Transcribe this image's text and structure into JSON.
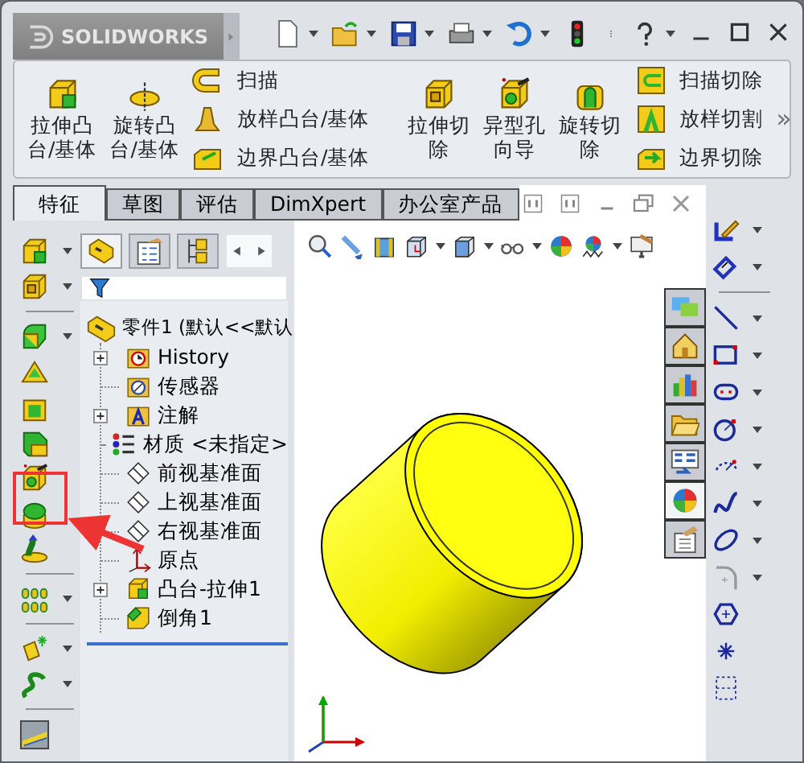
{
  "app": {
    "name": "SOLIDWORKS"
  },
  "ribbon": {
    "groups": [
      {
        "kind": "large",
        "lines": [
          "拉伸凸",
          "台/基体"
        ]
      },
      {
        "kind": "large",
        "lines": [
          "旋转凸",
          "台/基体"
        ]
      },
      {
        "kind": "stack",
        "items": [
          "扫描",
          "放样凸台/基体",
          "边界凸台/基体"
        ]
      },
      {
        "kind": "divider"
      },
      {
        "kind": "large",
        "lines": [
          "拉伸切",
          "除"
        ]
      },
      {
        "kind": "large",
        "lines": [
          "异型孔",
          "向导"
        ]
      },
      {
        "kind": "large",
        "lines": [
          "旋转切",
          "除"
        ]
      },
      {
        "kind": "stack",
        "items": [
          "扫描切除",
          "放样切割",
          "边界切除"
        ]
      }
    ],
    "more": "»"
  },
  "tabs": [
    {
      "label": "特征",
      "selected": true
    },
    {
      "label": "草图",
      "selected": false
    },
    {
      "label": "评估",
      "selected": false
    },
    {
      "label": "DimXpert",
      "selected": false
    },
    {
      "label": "办公室产品",
      "selected": false
    }
  ],
  "feature_manager": {
    "tabs": [
      {
        "selected": true
      },
      {
        "selected": false
      },
      {
        "selected": false
      }
    ],
    "tree": {
      "label": "零件1 (默认<<默认",
      "children": [
        {
          "label": "History",
          "expanded": false
        },
        {
          "label": "传感器"
        },
        {
          "label": "注解",
          "expanded": false
        },
        {
          "label": "材质 <未指定>"
        },
        {
          "label": "前视基准面"
        },
        {
          "label": "上视基准面"
        },
        {
          "label": "右视基准面"
        },
        {
          "label": "原点"
        },
        {
          "label": "凸台-拉伸1",
          "expanded": false
        },
        {
          "label": "倒角1"
        }
      ]
    }
  },
  "task_pane": {
    "tabs": [
      {
        "selected": false
      },
      {
        "selected": false
      },
      {
        "selected": false
      },
      {
        "selected": false
      },
      {
        "selected": false
      },
      {
        "selected": true
      },
      {
        "selected": false
      }
    ]
  }
}
